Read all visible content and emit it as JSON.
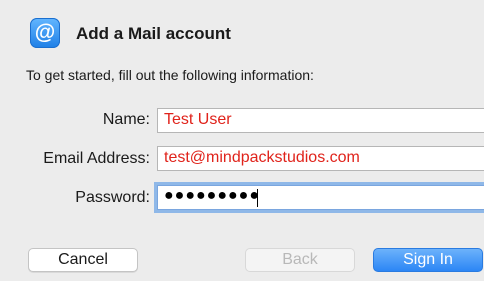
{
  "dialog": {
    "title": "Add a Mail account",
    "app_icon": "at-sign-icon",
    "intro": "To get started, fill out the following information:"
  },
  "form": {
    "name": {
      "label": "Name:",
      "value": "Test User"
    },
    "email": {
      "label": "Email Address:",
      "value": "test@mindpackstudios.com"
    },
    "password": {
      "label": "Password:",
      "masked_value": "●●●●●●●●●"
    }
  },
  "buttons": {
    "cancel": "Cancel",
    "back": "Back",
    "sign_in": "Sign In"
  },
  "colors": {
    "entered_text": "#e0231b",
    "accent": "#2c86f5",
    "focus_ring": "#8fb8e8"
  }
}
